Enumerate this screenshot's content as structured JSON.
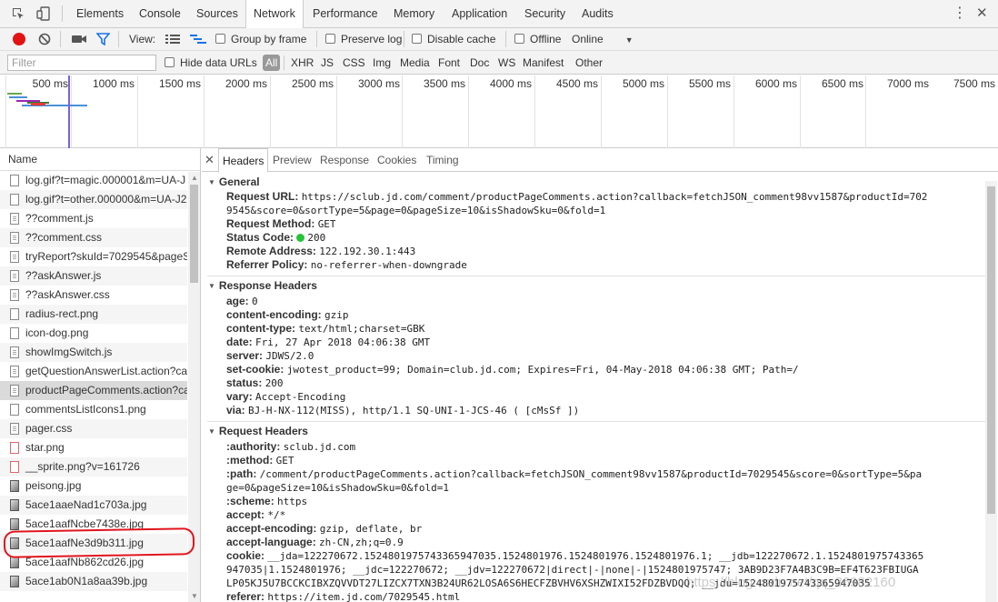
{
  "tabbar": {
    "tabs": [
      "Elements",
      "Console",
      "Sources",
      "Network",
      "Performance",
      "Memory",
      "Application",
      "Security",
      "Audits"
    ],
    "active": "Network",
    "more_icon": "kebab-icon",
    "close_icon": "close-icon"
  },
  "toolbar1": {
    "view_label": "View:",
    "group_by_frame": "Group by frame",
    "preserve_log": "Preserve log",
    "disable_cache": "Disable cache",
    "offline": "Offline",
    "throttle": "Online"
  },
  "toolbar2": {
    "filter_placeholder": "Filter",
    "hide_data_urls": "Hide data URLs",
    "types": [
      "All",
      "XHR",
      "JS",
      "CSS",
      "Img",
      "Media",
      "Font",
      "Doc",
      "WS",
      "Manifest",
      "Other"
    ],
    "active_type": "All"
  },
  "overview": {
    "ticks": [
      "500 ms",
      "1000 ms",
      "1500 ms",
      "2000 ms",
      "2500 ms",
      "3000 ms",
      "3500 ms",
      "4000 ms",
      "4500 ms",
      "5000 ms",
      "5500 ms",
      "6000 ms",
      "6500 ms",
      "7000 ms",
      "7500 ms"
    ]
  },
  "requests": {
    "header": "Name",
    "files": [
      "log.gif?t=magic.000001&m=UA-J",
      "log.gif?t=other.000000&m=UA-J2",
      "??comment.js",
      "??comment.css",
      "tryReport?skuId=7029545&pageS",
      "??askAnswer.js",
      "??askAnswer.css",
      "radius-rect.png",
      "icon-dog.png",
      "showImgSwitch.js",
      "getQuestionAnswerList.action?ca",
      "productPageComments.action?ca",
      "commentsListIcons1.png",
      "pager.css",
      "star.png",
      "__sprite.png?v=161726",
      "peisong.jpg",
      "5ace1aaeNad1c703a.jpg",
      "5ace1aafNcbe7438e.jpg",
      "5ace1aafNe3d9b311.jpg",
      "5ace1aafNb862cd26.jpg",
      "5ace1ab0N1a8aa39b.jpg"
    ],
    "selected_index": 11
  },
  "detail": {
    "tabs": [
      "Headers",
      "Preview",
      "Response",
      "Cookies",
      "Timing"
    ],
    "active_tab": "Headers",
    "general": {
      "title": "General",
      "request_url_label": "Request URL:",
      "request_url_1": "https://sclub.jd.com/comment/productPageComments.action?callback=fetchJSON_comment98vv1587&productId=702",
      "request_url_2": "9545&score=0&sortType=5&page=0&pageSize=10&isShadowSku=0&fold=1",
      "method_label": "Request Method:",
      "method": "GET",
      "status_label": "Status Code:",
      "status": "200",
      "remote_label": "Remote Address:",
      "remote": "122.192.30.1:443",
      "referrer_label": "Referrer Policy:",
      "referrer": "no-referrer-when-downgrade"
    },
    "response_headers": {
      "title": "Response Headers",
      "rows": [
        {
          "k": "age:",
          "v": "0"
        },
        {
          "k": "content-encoding:",
          "v": "gzip"
        },
        {
          "k": "content-type:",
          "v": "text/html;charset=GBK"
        },
        {
          "k": "date:",
          "v": "Fri, 27 Apr 2018 04:06:38 GMT"
        },
        {
          "k": "server:",
          "v": "JDWS/2.0"
        },
        {
          "k": "set-cookie:",
          "v": "jwotest_product=99; Domain=club.jd.com; Expires=Fri, 04-May-2018 04:06:38 GMT; Path=/"
        },
        {
          "k": "status:",
          "v": "200"
        },
        {
          "k": "vary:",
          "v": "Accept-Encoding"
        },
        {
          "k": "via:",
          "v": "BJ-H-NX-112(MISS), http/1.1 SQ-UNI-1-JCS-46 ( [cMsSf ])"
        }
      ]
    },
    "request_headers": {
      "title": "Request Headers",
      "authority_k": ":authority:",
      "authority_v": "sclub.jd.com",
      "method_k": ":method:",
      "method_v": "GET",
      "path_k": ":path:",
      "path_v1": "/comment/productPageComments.action?callback=fetchJSON_comment98vv1587&productId=7029545&score=0&sortType=5&pa",
      "path_v2": "ge=0&pageSize=10&isShadowSku=0&fold=1",
      "scheme_k": ":scheme:",
      "scheme_v": "https",
      "accept_k": "accept:",
      "accept_v": "*/*",
      "accept_enc_k": "accept-encoding:",
      "accept_enc_v": "gzip, deflate, br",
      "accept_lang_k": "accept-language:",
      "accept_lang_v": "zh-CN,zh;q=0.9",
      "cookie_k": "cookie:",
      "cookie_v1": "__jda=122270672.1524801975743365947035.1524801976.1524801976.1524801976.1; __jdb=122270672.1.1524801975743365",
      "cookie_v2": "947035|1.1524801976; __jdc=122270672; __jdv=122270672|direct|-|none|-|1524801975747; 3AB9D23F7A4B3C9B=EF4T623FBIUGA",
      "cookie_v3": "LP05KJ5U7BCCKCIBXZQVVDT27LIZCX7TXN3B24UR62LOSA6S6HECFZBVHV6XSHZWIXI52FDZBVDQQ; __jdu=1524801975743365947035",
      "referer_k": "referer:",
      "referer_v": "https://item.jd.com/7029545.html"
    }
  },
  "watermark": "https://blog.csdn.net/qq_36982160",
  "colors": {
    "record": "#e21313",
    "status_ok": "#27c23a",
    "annotation": "#e0141e",
    "filter_icon": "#1a73e8"
  }
}
